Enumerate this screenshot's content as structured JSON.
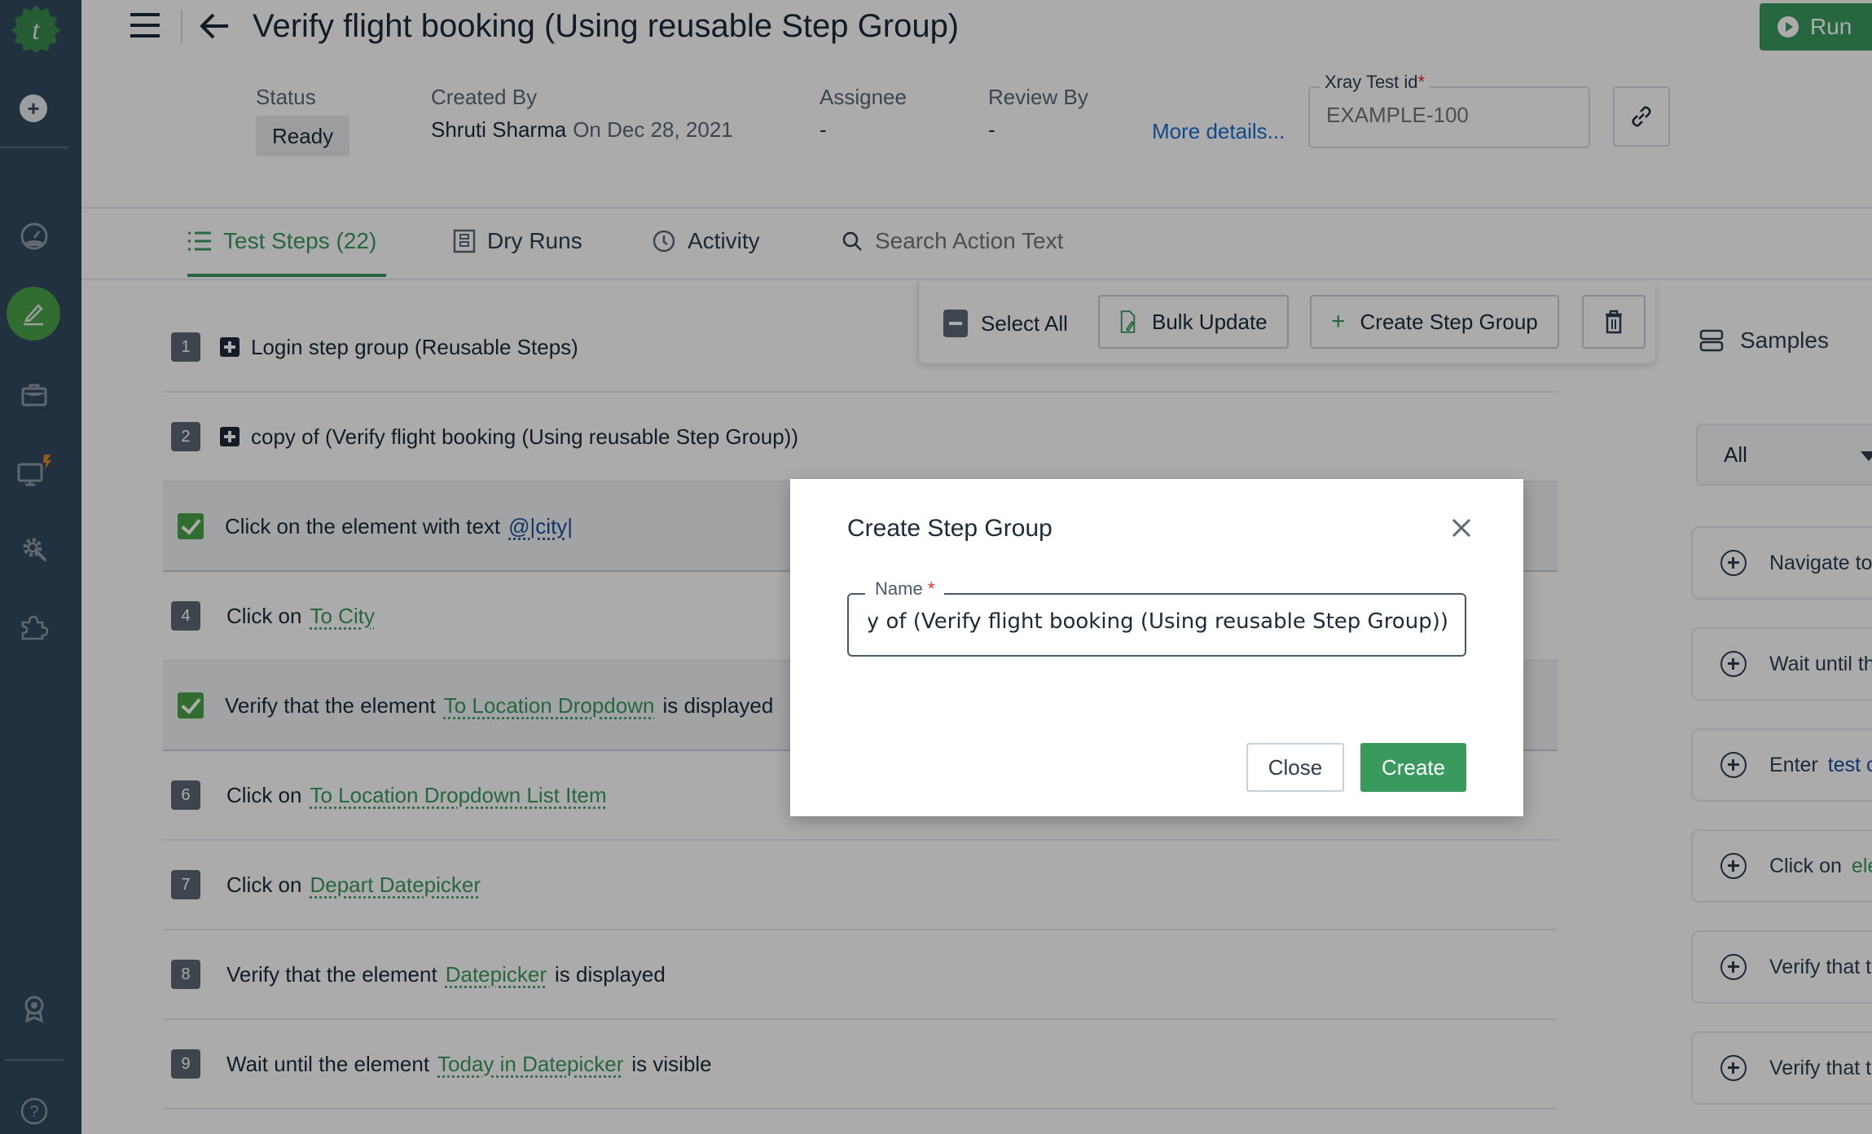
{
  "app": {
    "brand_color": "#3a9a5e",
    "sidebar_bg": "#34495e"
  },
  "sidebar": {
    "items": [
      {
        "name": "add",
        "icon": "plus-icon"
      },
      {
        "name": "dashboard",
        "icon": "dashboard-gauge-icon"
      },
      {
        "name": "test-development",
        "icon": "pencil-icon",
        "active": true
      },
      {
        "name": "projects",
        "icon": "briefcase-icon"
      },
      {
        "name": "agents",
        "icon": "monitor-icon",
        "badge": "lightning-icon"
      },
      {
        "name": "settings",
        "icon": "gear-wrench-icon"
      },
      {
        "name": "addons",
        "icon": "puzzle-icon"
      },
      {
        "name": "rewards",
        "icon": "badge-icon"
      },
      {
        "name": "help",
        "icon": "help-icon"
      }
    ]
  },
  "header": {
    "title": "Verify flight booking (Using reusable Step Group)",
    "run_label": "Run",
    "status_label": "Status",
    "status_value": "Ready",
    "created_by_label": "Created By",
    "created_by_name": "Shruti Sharma",
    "created_on": "On Dec 28, 2021",
    "assignee_label": "Assignee",
    "assignee_value": "-",
    "review_by_label": "Review By",
    "review_by_value": "-",
    "more_details": "More details...",
    "xray_label": "Xray Test id",
    "xray_required": "*",
    "xray_placeholder": "EXAMPLE-100"
  },
  "tabs": [
    {
      "label": "Test Steps (22)",
      "active": true
    },
    {
      "label": "Dry Runs"
    },
    {
      "label": "Activity"
    }
  ],
  "search": {
    "placeholder": "Search Action Text"
  },
  "toolbar": {
    "select_all": "Select All",
    "bulk_update": "Bulk Update",
    "create_step_group": "Create Step Group"
  },
  "steps": [
    {
      "num": "1",
      "type": "group",
      "text": "Login step group (Reusable Steps)"
    },
    {
      "num": "2",
      "type": "group",
      "text": "copy of (Verify flight booking (Using reusable Step Group))"
    },
    {
      "num": "3",
      "selected": true,
      "pre": "Click on the element with text",
      "param": "@|city|",
      "post": ""
    },
    {
      "num": "4",
      "pre": "Click on",
      "element": "To City",
      "post": ""
    },
    {
      "num": "5",
      "selected": true,
      "pre": "Verify that the element",
      "element": "To Location Dropdown",
      "post": "is displayed"
    },
    {
      "num": "6",
      "pre": "Click on",
      "element": "To Location Dropdown List Item",
      "post": ""
    },
    {
      "num": "7",
      "pre": "Click on",
      "element": "Depart Datepicker",
      "post": ""
    },
    {
      "num": "8",
      "pre": "Verify that the element",
      "element": "Datepicker",
      "post": "is displayed"
    },
    {
      "num": "9",
      "pre": "Wait until the element",
      "element": "Today in Datepicker",
      "post": "is visible"
    }
  ],
  "samples": {
    "title": "Samples",
    "filter_value": "All",
    "items": [
      {
        "text": "Navigate to"
      },
      {
        "text": "Wait until th"
      },
      {
        "text": "Enter",
        "param": "test c"
      },
      {
        "text": "Click on",
        "element": "ele"
      },
      {
        "text": "Verify that t"
      },
      {
        "text": "Verify that t"
      }
    ]
  },
  "modal": {
    "title": "Create Step Group",
    "name_label": "Name",
    "name_required": "*",
    "name_value": "copy of (Verify flight booking (Using reusable Step Group))",
    "close_label": "Close",
    "create_label": "Create"
  }
}
